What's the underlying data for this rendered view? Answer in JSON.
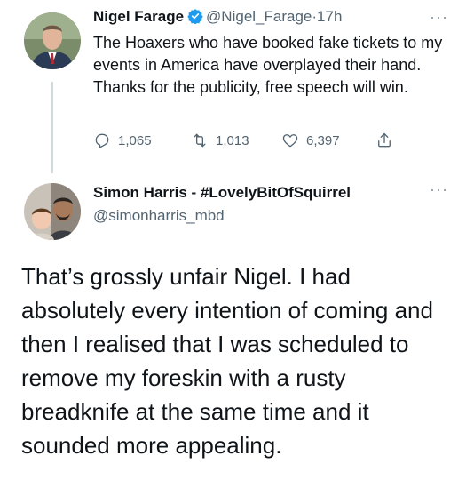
{
  "tweet1": {
    "author_name": "Nigel Farage",
    "handle": "@Nigel_Farage",
    "separator": "·",
    "time": "17h",
    "text": "The Hoaxers who have booked fake tickets to my events in America have overplayed their hand. Thanks for the publicity, free speech will win.",
    "replies": "1,065",
    "retweets": "1,013",
    "likes": "6,397",
    "more_label": "···",
    "verified_color": "#1d9bf0"
  },
  "tweet2": {
    "author_name": "Simon Harris - #LovelyBitOfSquirrel",
    "handle": "@simonharris_mbd",
    "text": "That’s grossly unfair Nigel. I had absolutely every intention of coming and then I realised that I was scheduled to remove my foreskin with a rusty breadknife at the same time and it sounded more appealing.",
    "more_label": "···"
  },
  "icons": {
    "reply": "reply-icon",
    "retweet": "retweet-icon",
    "like": "heart-icon",
    "share": "share-icon",
    "verified": "verified-badge-icon"
  },
  "colors": {
    "text": "#0f1419",
    "secondary": "#536471",
    "thread_line": "#cfd9de"
  }
}
